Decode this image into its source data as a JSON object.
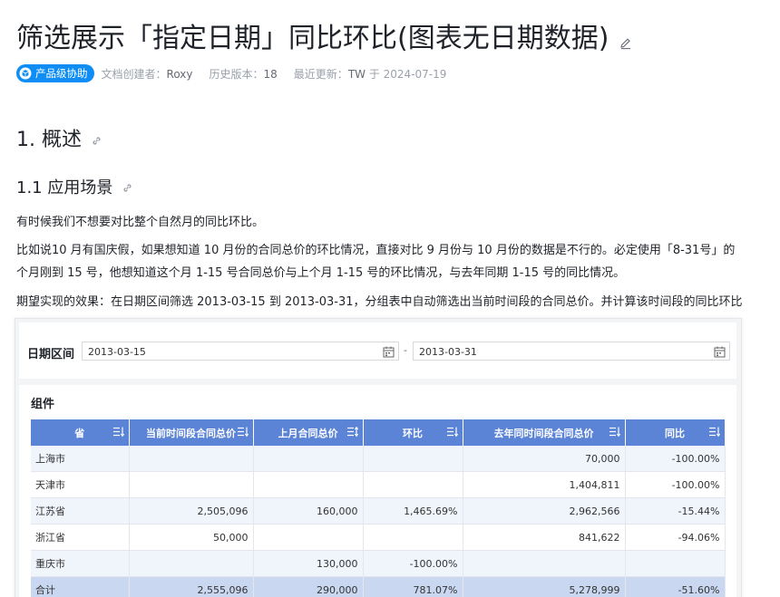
{
  "doc": {
    "title": "筛选展示「指定日期」同比环比(图表无日期数据)"
  },
  "meta": {
    "badge": "产品级协助",
    "creator_label": "文档创建者：",
    "creator": "Roxy",
    "version_label": "历史版本：",
    "version": "18",
    "updated_label": "最近更新：",
    "updated_by": "TW",
    "updated_on": " 于 2024-07-19"
  },
  "section1": {
    "heading": "1. 概述"
  },
  "section11": {
    "heading": "1.1 应用场景"
  },
  "paragraphs": {
    "p1": "有时候我们不想要对比整个自然月的同比环比。",
    "p2": "比如说10 月有国庆假，如果想知道 10 月份的合同总价的环比情况，直接对比 9 月份与 10 月份的数据是不行的。必定使用「8-31号」的",
    "p3": "个月刚到 15 号，他想知道这个月 1-15 号合同总价与上个月 1-15 号的环比情况，与去年同期 1-15 号的同比情况。",
    "p4": "期望实现的效果：在日期区间筛选 2013-03-15 到 2013-03-31，分组表中自动筛选出当前时间段的合同总价。并计算该时间段的同比环比"
  },
  "embed": {
    "filter_label": "日期区间",
    "date_start": "2013-03-15",
    "date_separator": "-",
    "date_end": "2013-03-31",
    "panel_title": "组件",
    "columns": [
      "省",
      "当前时间段合同总价",
      "上月合同总价",
      "环比",
      "去年同时间段合同总价",
      "同比"
    ],
    "rows": [
      {
        "name": "上海市",
        "cur": "",
        "last_month": "",
        "mom": "",
        "last_year": "70,000",
        "yoy": "-100.00%"
      },
      {
        "name": "天津市",
        "cur": "",
        "last_month": "",
        "mom": "",
        "last_year": "1,404,811",
        "yoy": "-100.00%"
      },
      {
        "name": "江苏省",
        "cur": "2,505,096",
        "last_month": "160,000",
        "mom": "1,465.69%",
        "last_year": "2,962,566",
        "yoy": "-15.44%"
      },
      {
        "name": "浙江省",
        "cur": "50,000",
        "last_month": "",
        "mom": "",
        "last_year": "841,622",
        "yoy": "-94.06%"
      },
      {
        "name": "重庆市",
        "cur": "",
        "last_month": "130,000",
        "mom": "-100.00%",
        "last_year": "",
        "yoy": ""
      },
      {
        "name": "合计",
        "cur": "2,555,096",
        "last_month": "290,000",
        "mom": "781.07%",
        "last_year": "5,278,999",
        "yoy": "-51.60%"
      }
    ]
  },
  "colors": {
    "badge": "#0e8df5",
    "header": "#5b83d6",
    "alt_row": "#f0f4fb",
    "total_row": "#c9d7f0"
  }
}
